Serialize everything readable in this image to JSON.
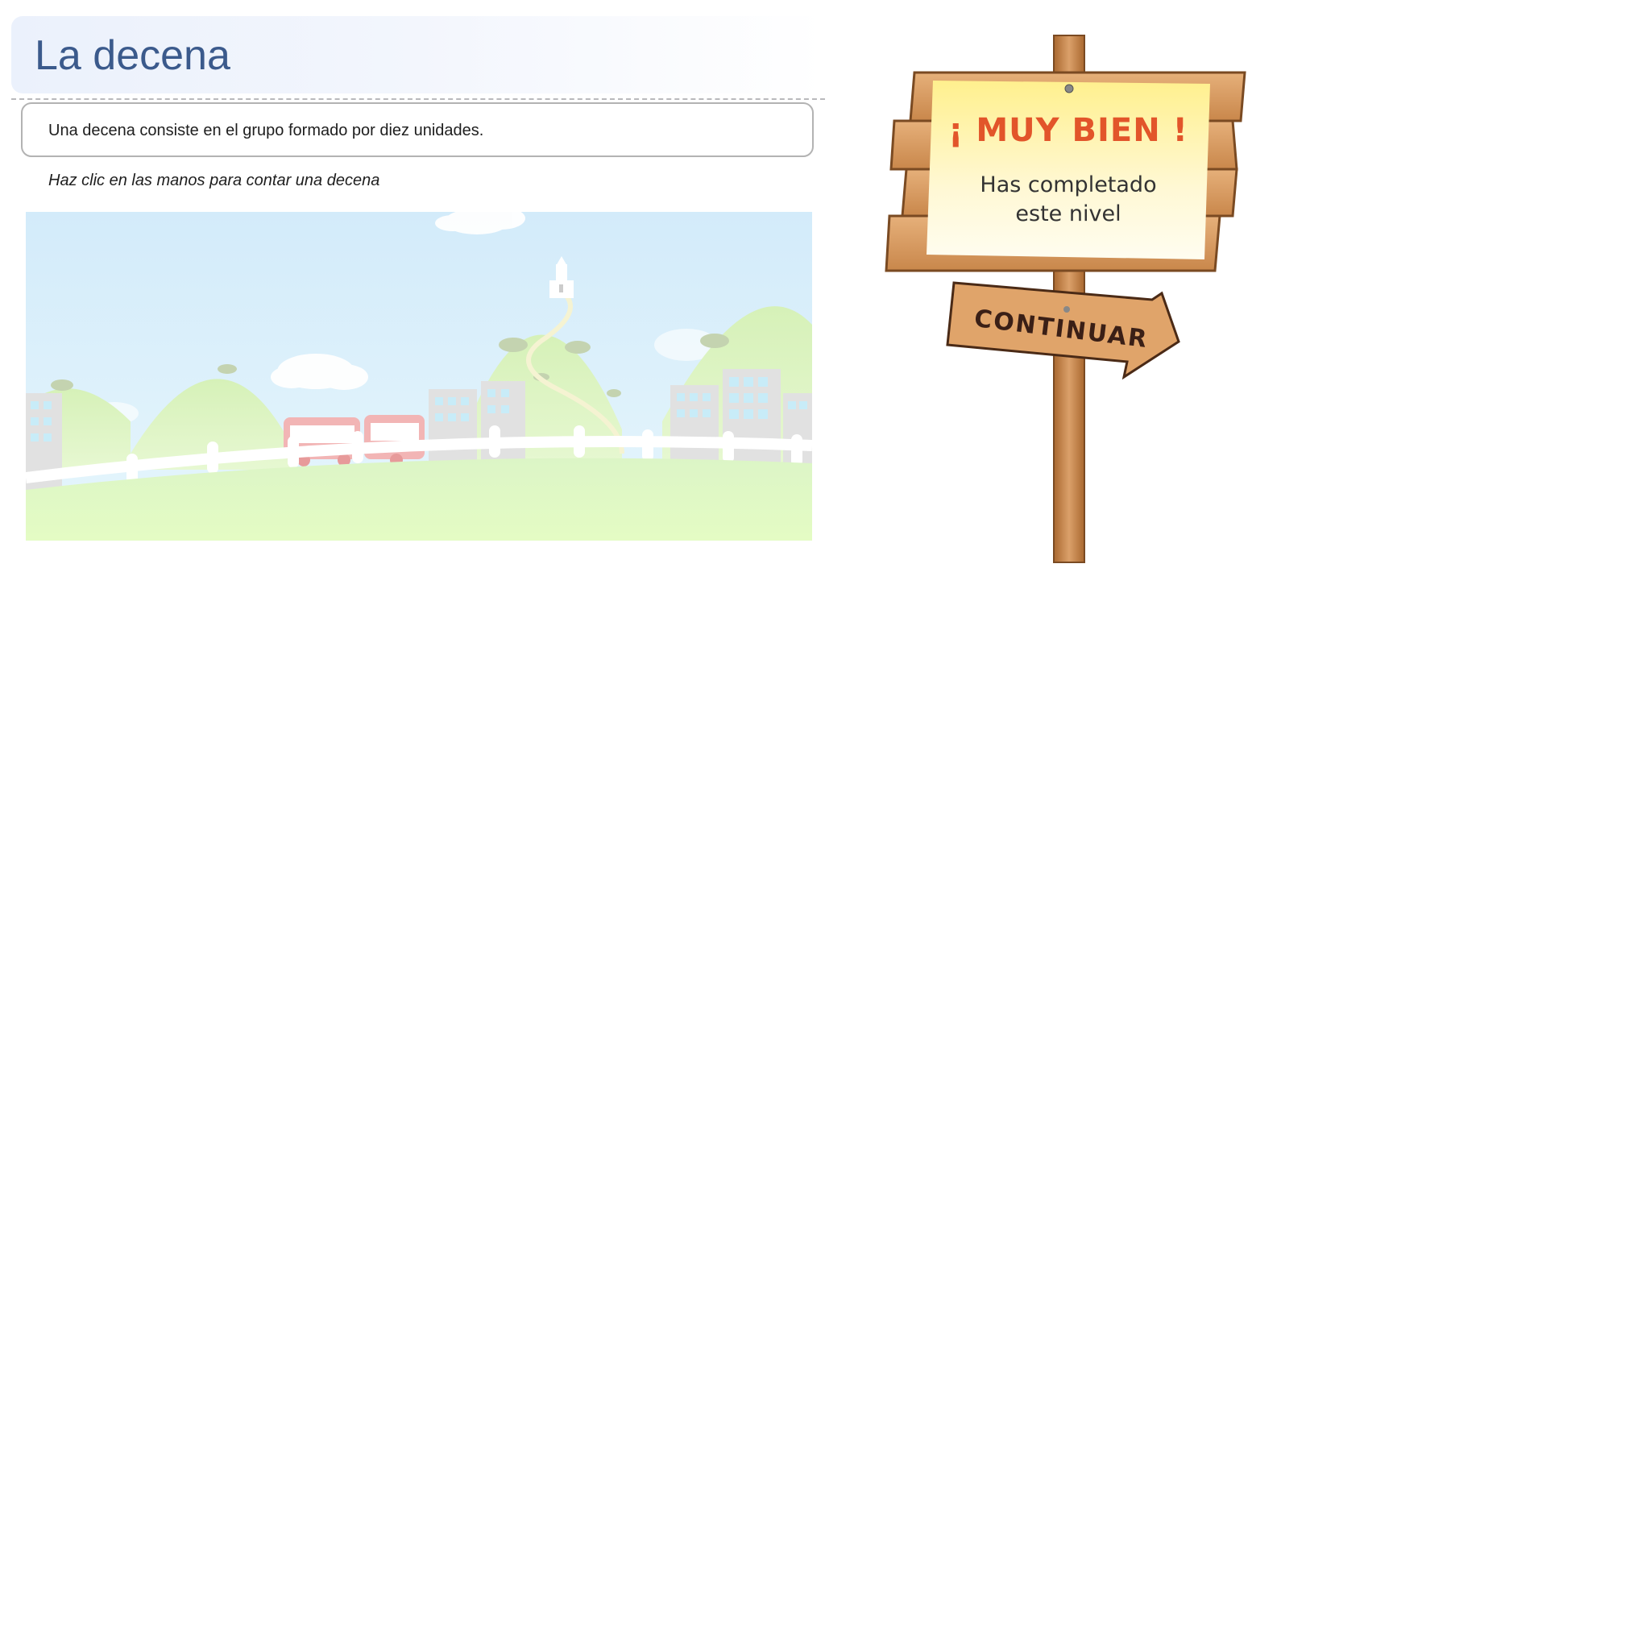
{
  "page": {
    "title": "La decena"
  },
  "definition": {
    "text": "Una decena consiste en el grupo formado por diez unidades."
  },
  "instruction": {
    "text": "Haz clic en las manos para contar una decena"
  },
  "sign": {
    "title": "¡ MUY BIEN !",
    "subtitle_line1": "Has completado",
    "subtitle_line2": "este nivel",
    "continue_label": "CONTINUAR"
  },
  "colors": {
    "title_text": "#3b5a8c",
    "sign_title": "#e2552a",
    "wood": "#d89a5a",
    "wood_dark": "#7a4a22"
  }
}
